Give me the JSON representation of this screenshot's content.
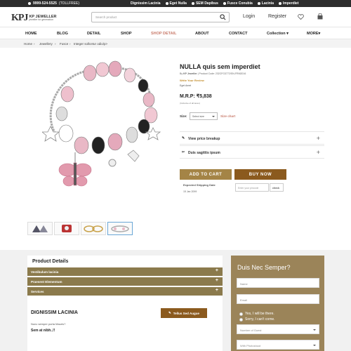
{
  "topbar": {
    "phone": "9999-524-5525",
    "tollfree": "(TOLLFREE)",
    "links": [
      "Dignissim Lacinia",
      "Eget Nulla",
      "SEM Dapibus",
      "Fusce Conubia",
      "Lacinia",
      "Imperdiet"
    ]
  },
  "header": {
    "logo_mark": "KPJ",
    "logo_title": "KP JEWELLER",
    "logo_tagline": "jeweller for generation",
    "search_placeholder": "Search product",
    "login": "Login",
    "register": "Register"
  },
  "nav": {
    "items": [
      "HOME",
      "BLOG",
      "DETAIL",
      "SHOP",
      "SHOP DETAIL",
      "ABOUT",
      "CONTACT",
      "Collection",
      "MORE"
    ]
  },
  "breadcrumb": {
    "items": [
      "Home",
      "Jewellery",
      "Fusce",
      "Integer sollcetur odio/p>"
    ]
  },
  "product": {
    "title": "NULLA quis sem imperdiet",
    "by_label": "By",
    "brand": "KP Jeweller",
    "code": "| Product Code: 232CFG3772/SN-FRM2016",
    "review": "Write Your Review",
    "sub": "Eget Amet",
    "mrp_label": "M.R.P:",
    "price": "₹5,838",
    "tax_note": "(Inclusive of all taxes)",
    "size_label": "Size:",
    "size_value": "Select size",
    "size_chart": "Size chart",
    "accordions": [
      "View price breakup",
      "Duis sagittis ipsum"
    ],
    "add_to_cart": "ADD TO CART",
    "buy_now": "BUY NOW",
    "shipping_label": "Expected Shipping Date",
    "shipping_date": "15 Jan 2099",
    "pincode_placeholder": "Enter your pincode",
    "check": "check"
  },
  "details": {
    "title": "Product Details",
    "bars": [
      "Vestibulum lacinia",
      "Praesent Elementum",
      "Services"
    ],
    "section_title": "DIGNISSIM LACINIA",
    "button": "Tellus Sed Augue",
    "question": "Nunc semper porta Mauris?",
    "answer": "Sem at nibh..!!"
  },
  "form": {
    "title": "Duis Nec Semper?",
    "name": "Name",
    "email": "Email",
    "yes": "Yes, I will be there.",
    "no": "Sorry, I can't come.",
    "guests": "Number of Guest",
    "extra": "With Photoshoot"
  },
  "colors": {
    "accent_gold": "#a48446",
    "accent_brown": "#8b5a1e",
    "nav_active": "#c97b6b"
  }
}
